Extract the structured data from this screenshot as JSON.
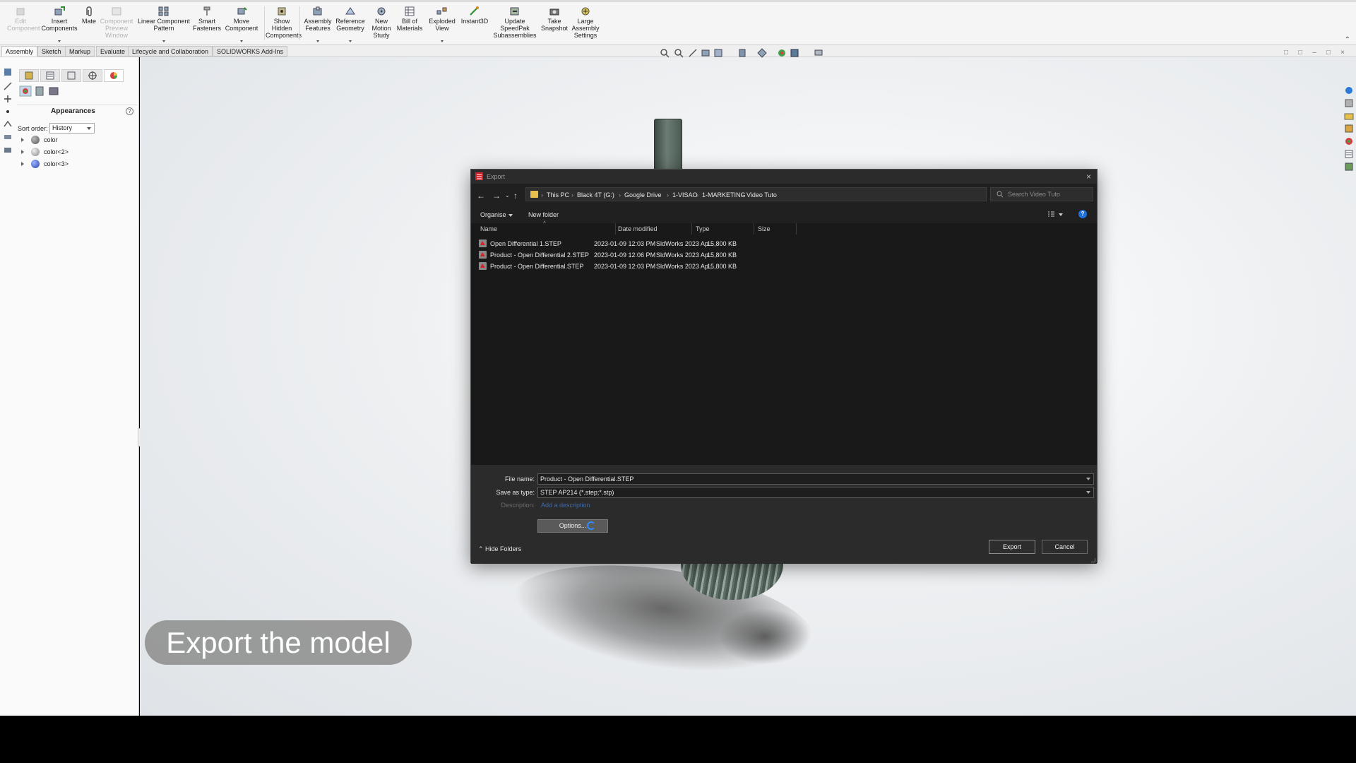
{
  "ribbon": {
    "buttons": [
      {
        "id": "edit-component",
        "label": "Edit\nComponent",
        "disabled": true
      },
      {
        "id": "insert-components",
        "label": "Insert\nComponents",
        "disabled": false
      },
      {
        "id": "mate",
        "label": "Mate",
        "disabled": false
      },
      {
        "id": "component-preview-window",
        "label": "Component\nPreview\nWindow",
        "disabled": true
      },
      {
        "id": "linear-component-pattern",
        "label": "Linear Component\nPattern",
        "disabled": false
      },
      {
        "id": "smart-fasteners",
        "label": "Smart\nFasteners",
        "disabled": false
      },
      {
        "id": "move-component",
        "label": "Move\nComponent",
        "disabled": false
      },
      {
        "id": "show-hidden-components",
        "label": "Show\nHidden\nComponents",
        "disabled": false
      },
      {
        "id": "assembly-features",
        "label": "Assembly\nFeatures",
        "disabled": false
      },
      {
        "id": "reference-geometry",
        "label": "Reference\nGeometry",
        "disabled": false
      },
      {
        "id": "new-motion-study",
        "label": "New\nMotion\nStudy",
        "disabled": false
      },
      {
        "id": "bill-of-materials",
        "label": "Bill of\nMaterials",
        "disabled": false
      },
      {
        "id": "exploded-view",
        "label": "Exploded\nView",
        "disabled": false
      },
      {
        "id": "instant3d",
        "label": "Instant3D",
        "disabled": false
      },
      {
        "id": "update-speedpak",
        "label": "Update\nSpeedPak\nSubassemblies",
        "disabled": false
      },
      {
        "id": "take-snapshot",
        "label": "Take\nSnapshot",
        "disabled": false
      },
      {
        "id": "large-assembly-settings",
        "label": "Large\nAssembly\nSettings",
        "disabled": false
      }
    ]
  },
  "tabs": [
    "Assembly",
    "Sketch",
    "Markup",
    "Evaluate",
    "Lifecycle and Collaboration",
    "SOLIDWORKS Add-Ins"
  ],
  "active_tab": "Assembly",
  "left_pane": {
    "title": "Appearances",
    "help": "?",
    "sort_label": "Sort order:",
    "sort_value": "History",
    "items": [
      {
        "label": "color",
        "color": "#6b6b6b"
      },
      {
        "label": "color<2>",
        "color": "#9a9a9a"
      },
      {
        "label": "color<3>",
        "color": "#3b5bbf"
      }
    ]
  },
  "caption": "Export the model",
  "dialog": {
    "title": "Export",
    "breadcrumb": [
      "This PC",
      "Black 4T (G:)",
      "Google Drive",
      "1-VISAO",
      "1-MARKETING",
      "Video Tuto"
    ],
    "search_placeholder": "Search Video Tuto",
    "organise": "Organise",
    "new_folder": "New folder",
    "help": "?",
    "columns": {
      "name": "Name",
      "date": "Date modified",
      "type": "Type",
      "size": "Size"
    },
    "files": [
      {
        "name": "Open Differential 1.STEP",
        "date": "2023-01-09 12:03 PM",
        "type": "SldWorks 2023 Ap...",
        "size": "15,800 KB"
      },
      {
        "name": "Product - Open Differential 2.STEP",
        "date": "2023-01-09 12:06 PM",
        "type": "SldWorks 2023 Ap...",
        "size": "15,800 KB"
      },
      {
        "name": "Product - Open Differential.STEP",
        "date": "2023-01-09 12:03 PM",
        "type": "SldWorks 2023 Ap...",
        "size": "15,800 KB"
      }
    ],
    "file_name_label": "File name:",
    "file_name_value": "Product - Open Differential.STEP",
    "save_type_label": "Save as type:",
    "save_type_value": "STEP AP214 (*.step;*.stp)",
    "description_label": "Description:",
    "description_link": "Add a description",
    "options_label": "Options...",
    "hide_folders": "Hide Folders",
    "export_label": "Export",
    "cancel_label": "Cancel"
  },
  "colors": {
    "accent": "#1e6fd9",
    "dialog_bg": "#202020",
    "folder": "#e7c14b"
  }
}
